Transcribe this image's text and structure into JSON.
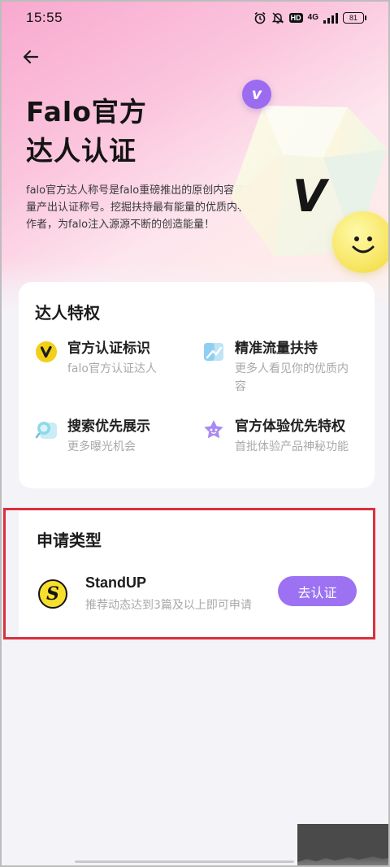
{
  "status_bar": {
    "time": "15:55",
    "network": "4G",
    "hd": "HD",
    "battery": "81"
  },
  "hero": {
    "title_line1": "Falo官方",
    "title_line2": "达人认证",
    "description": "falo官方达人称号是falo重磅推出的原创内容高质量产出认证称号。挖掘扶持最有能量的优质内容创作者，为falo注入源源不断的创造能量！",
    "badge_letter": "v",
    "gem_letter": "V"
  },
  "privileges": {
    "title": "达人特权",
    "items": [
      {
        "title": "官方认证标识",
        "desc": "falo官方认证达人",
        "icon": "v-badge-icon"
      },
      {
        "title": "精准流量扶持",
        "desc": "更多人看见你的优质内容",
        "icon": "traffic-icon"
      },
      {
        "title": "搜索优先展示",
        "desc": "更多曝光机会",
        "icon": "search-icon"
      },
      {
        "title": "官方体验优先特权",
        "desc": "首批体验产品神秘功能",
        "icon": "star-icon"
      }
    ]
  },
  "apply": {
    "title": "申请类型",
    "item_logo": "S",
    "item_name": "StandUP",
    "item_desc": "推荐动态达到3篇及以上即可申请",
    "button_label": "去认证"
  },
  "colors": {
    "accent_purple": "#9c72f3",
    "badge_yellow": "#f2cf1a",
    "highlight_red": "#d9303e"
  }
}
